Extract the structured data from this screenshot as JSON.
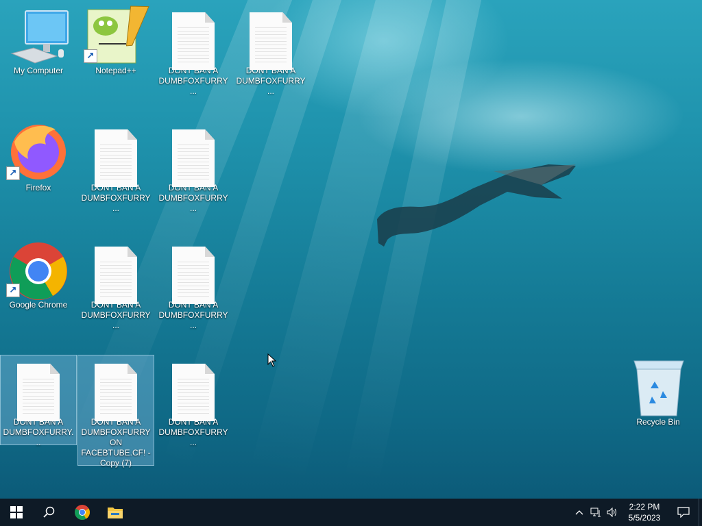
{
  "desktop": {
    "icons": [
      {
        "label": "My Computer"
      },
      {
        "label": "Notepad++"
      },
      {
        "label": "DONT BAN A DUMBFOXFURRY ..."
      },
      {
        "label": "DONT BAN A DUMBFOXFURRY ..."
      },
      {
        "label": "Firefox"
      },
      {
        "label": "DONT BAN A DUMBFOXFURRY ..."
      },
      {
        "label": "DONT BAN A DUMBFOXFURRY ..."
      },
      {
        "label": "Google Chrome"
      },
      {
        "label": "DONT BAN A DUMBFOXFURRY ..."
      },
      {
        "label": "DONT BAN A DUMBFOXFURRY ..."
      },
      {
        "label": "DONT BAN A DUMBFOXFURRY..."
      },
      {
        "label": "DONT BAN A DUMBFOXFURRY ON FACEBTUBE.CF! - Copy (7)"
      },
      {
        "label": "DONT BAN A DUMBFOXFURRY ..."
      },
      {
        "label": "Recycle Bin"
      }
    ]
  },
  "taskbar": {
    "icons": [
      "windows-start-icon",
      "search-icon",
      "chrome-icon",
      "file-explorer-icon"
    ],
    "clock": {
      "time": "2:22 PM",
      "date": "5/5/2023"
    }
  },
  "colors": {
    "taskbar": "#0e1a26",
    "selection": "#78b4d7"
  }
}
